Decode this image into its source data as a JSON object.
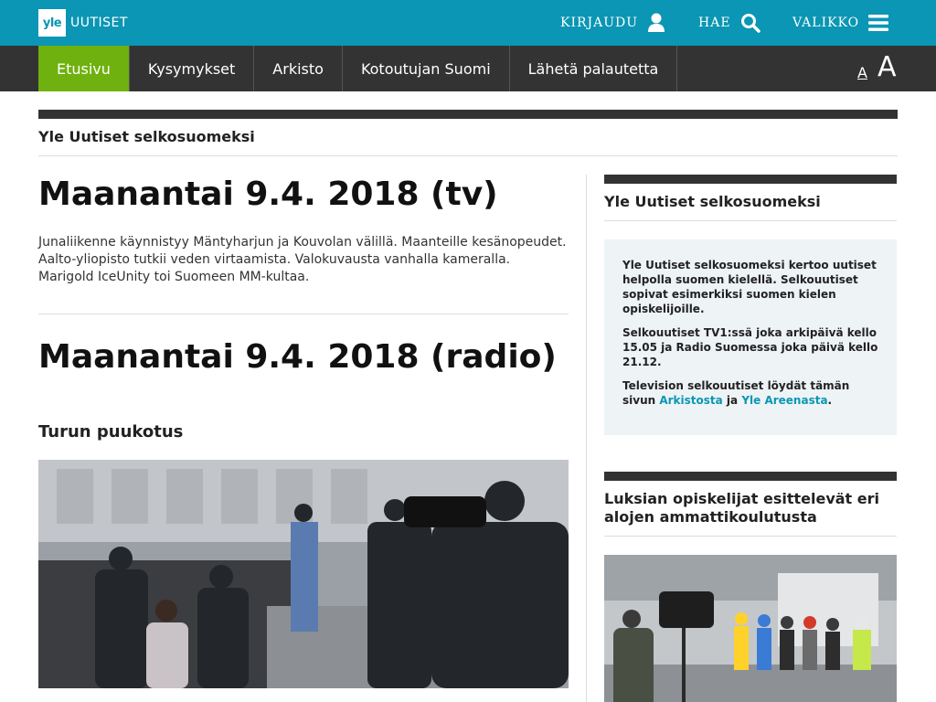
{
  "header": {
    "logo_mark": "yle",
    "logo_text": "UUTISET",
    "login_label": "KIRJAUDU",
    "search_label": "HAE",
    "menu_label": "VALIKKO",
    "icons": {
      "login": "user-icon",
      "search": "search-icon",
      "menu": "hamburger-icon"
    },
    "colors": {
      "brand": "#0a96b4",
      "active_tab": "#6fb10f",
      "nav_bg": "#333333"
    }
  },
  "nav": {
    "tabs": [
      {
        "label": "Etusivu",
        "active": true
      },
      {
        "label": "Kysymykset",
        "active": false
      },
      {
        "label": "Arkisto",
        "active": false
      },
      {
        "label": "Kotoutujan Suomi",
        "active": false
      },
      {
        "label": "Lähetä palautetta",
        "active": false
      }
    ],
    "font_small": "A",
    "font_large": "A"
  },
  "section": {
    "title": "Yle Uutiset selkosuomeksi"
  },
  "main": {
    "tv_headline": "Maanantai 9.4. 2018 (tv)",
    "tv_summary": "Junaliikenne käynnistyy Mäntyharjun ja Kouvolan välillä. Maanteille kesänopeudet. Aalto-yliopisto tutkii veden virtaamista. Valokuvausta vanhalla kameralla. Marigold IceUnity toi Suomeen MM-kultaa.",
    "radio_headline": "Maanantai 9.4. 2018 (radio)",
    "story_title": "Turun puukotus"
  },
  "sidebar": {
    "block1_title": "Yle Uutiset selkosuomeksi",
    "info_p1": "Yle Uutiset selkosuomeksi kertoo uutiset helpolla suomen kielellä. Selkouutiset sopivat esimerkiksi suomen kielen opiskelijoille.",
    "info_p2": "Selkouutiset TV1:ssä joka arkipäivä kello 15.05 ja Radio Suomessa joka päivä kello 21.12.",
    "info_p3_prefix": "Television selkouutiset löydät tämän sivun ",
    "info_link1": "Arkistosta",
    "info_p3_mid": " ja ",
    "info_link2": "Yle Areenasta",
    "info_p3_suffix": ".",
    "block2_title": "Luksian opiskelijat esittelevät eri alojen ammattikoulutusta"
  }
}
